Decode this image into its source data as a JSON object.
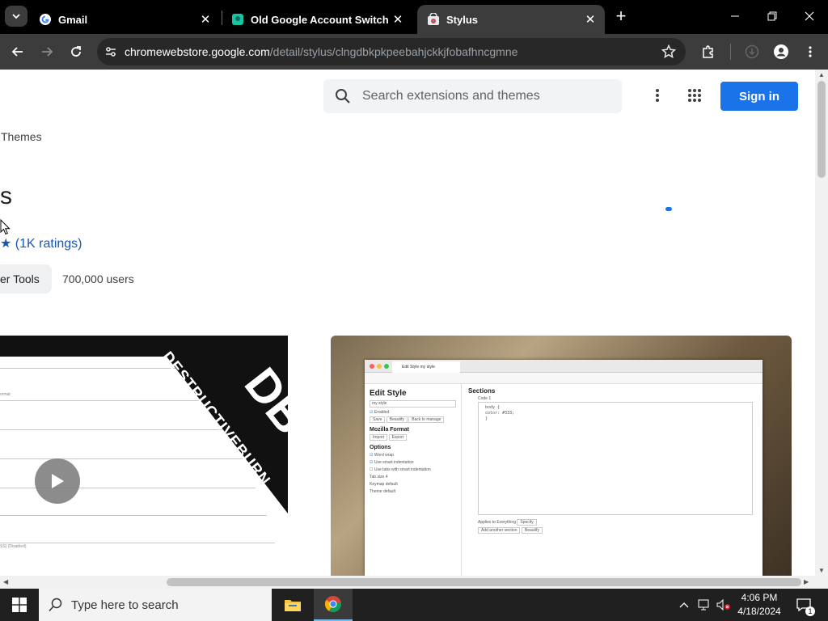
{
  "browser": {
    "tabs": [
      {
        "title": "Gmail",
        "favicon": "gmail-icon",
        "active": false
      },
      {
        "title": "Old Google Account Switcher",
        "favicon": "extension-puzzle-icon",
        "active": false
      },
      {
        "title": "Stylus",
        "favicon": "chrome-webstore-icon",
        "active": true
      }
    ],
    "url_host": "chromewebstore.google.com",
    "url_path": "/detail/stylus/clngdbkpkpeebahjckkjfobafhncgmne"
  },
  "store": {
    "search_placeholder": "Search extensions and themes",
    "signin_label": "Sign in",
    "nav_themes": "Themes",
    "extension_title_fragment": "s",
    "ratings_fragment": "(1K ratings)",
    "category_chip_fragment": "er Tools",
    "users": "700,000 users",
    "accent": "#1a73e8"
  },
  "screenshot_preview": {
    "video_overlay_text": "DESTRUCTIVEBURN",
    "video_logo": "DB",
    "edit_style_title": "Edit Style",
    "edit_style_name": "my style",
    "enabled_label": "Enabled",
    "buttons": [
      "Save",
      "Beautify",
      "Back to manage"
    ],
    "mozilla_format": "Mozilla Format",
    "import_label": "Import",
    "export_label": "Export",
    "options_title": "Options",
    "options": [
      "Word wrap",
      "Use smart indentation",
      "Use tabs with smart indentation"
    ],
    "tab_size_label": "Tab size",
    "tab_size_value": "4",
    "keymap_label": "Keymap",
    "keymap_value": "default",
    "theme_label": "Theme",
    "theme_value": "default",
    "sections_title": "Sections",
    "code_label": "Code 1",
    "code_lines": [
      "body {",
      "  color: #333;",
      "}"
    ],
    "applies_to": "Applies to",
    "everything": "Everything",
    "specify": "Specify",
    "add_section": "Add another section",
    "beautify": "Beautify"
  },
  "taskbar": {
    "search_placeholder": "Type here to search",
    "time": "4:06 PM",
    "date": "4/18/2024",
    "notification_count": "1"
  }
}
